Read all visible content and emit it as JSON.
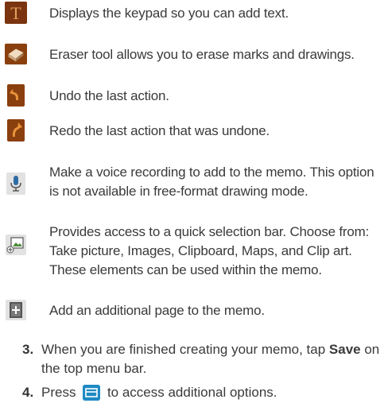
{
  "icons": [
    {
      "icon": "text-icon",
      "text": "Displays the keypad so you can add text."
    },
    {
      "icon": "eraser-icon",
      "text": "Eraser tool allows you to erase marks and drawings."
    },
    {
      "icon": "undo-icon",
      "text": "Undo the last action."
    },
    {
      "icon": "redo-icon",
      "text": "Redo the last action that was undone."
    },
    {
      "icon": "microphone-icon",
      "line1": "Make a voice recording to add to the memo. This option",
      "line2": "is not available in free-format drawing mode."
    },
    {
      "icon": "insert-icon",
      "line1": "Provides access to a quick selection bar. Choose from:",
      "line2": "Take picture, Images, Clipboard, Maps, and Clip art.",
      "line3": "These elements can be used within the memo."
    },
    {
      "icon": "add-page-icon",
      "text": "Add an additional page to the memo."
    }
  ],
  "steps": [
    {
      "num": "3.",
      "pre": "When you are finished creating your memo, tap ",
      "bold": "Save",
      "post": " on",
      "line2": "the top menu bar."
    },
    {
      "num": "4.",
      "pre": "Press",
      "post": "to access additional options.",
      "key_icon": "menu-key-icon"
    }
  ],
  "colors": {
    "icon_brown": "#8a3f0e",
    "icon_orange": "#d67a2a",
    "menu_key_blue": "#1e8ac4"
  }
}
